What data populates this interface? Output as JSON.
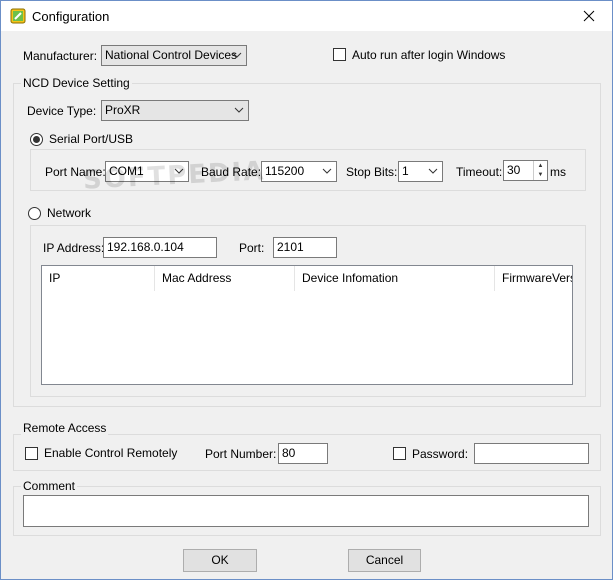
{
  "window": {
    "title": "Configuration"
  },
  "manufacturer": {
    "label": "Manufacturer:",
    "value": "National Control Devices"
  },
  "auto_run": {
    "label": "Auto run after login Windows",
    "checked": false
  },
  "ncd_device": {
    "group_title": "NCD Device Setting",
    "device_type_label": "Device Type:",
    "device_type_value": "ProXR"
  },
  "serial": {
    "radio_label": "Serial Port/USB",
    "selected": true,
    "port_name_label": "Port Name:",
    "port_name_value": "COM1",
    "baud_rate_label": "Baud Rate:",
    "baud_rate_value": "115200",
    "stop_bits_label": "Stop Bits:",
    "stop_bits_value": "1",
    "timeout_label": "Timeout:",
    "timeout_value": "30",
    "timeout_unit": "ms"
  },
  "network": {
    "radio_label": "Network",
    "selected": false,
    "ip_label": "IP Address:",
    "ip_value": "192.168.0.104",
    "port_label": "Port:",
    "port_value": "2101",
    "columns": [
      "IP",
      "Mac Address",
      "Device Infomation",
      "FirmwareVersion"
    ]
  },
  "remote_access": {
    "group_title": "Remote Access",
    "enable_label": "Enable Control Remotely",
    "enable_checked": false,
    "port_number_label": "Port Number:",
    "port_number_value": "80",
    "password_label": "Password:",
    "password_checked": false,
    "password_value": ""
  },
  "comment": {
    "group_title": "Comment",
    "value": ""
  },
  "buttons": {
    "ok": "OK",
    "cancel": "Cancel"
  },
  "watermark": "SOFTPEDIA"
}
